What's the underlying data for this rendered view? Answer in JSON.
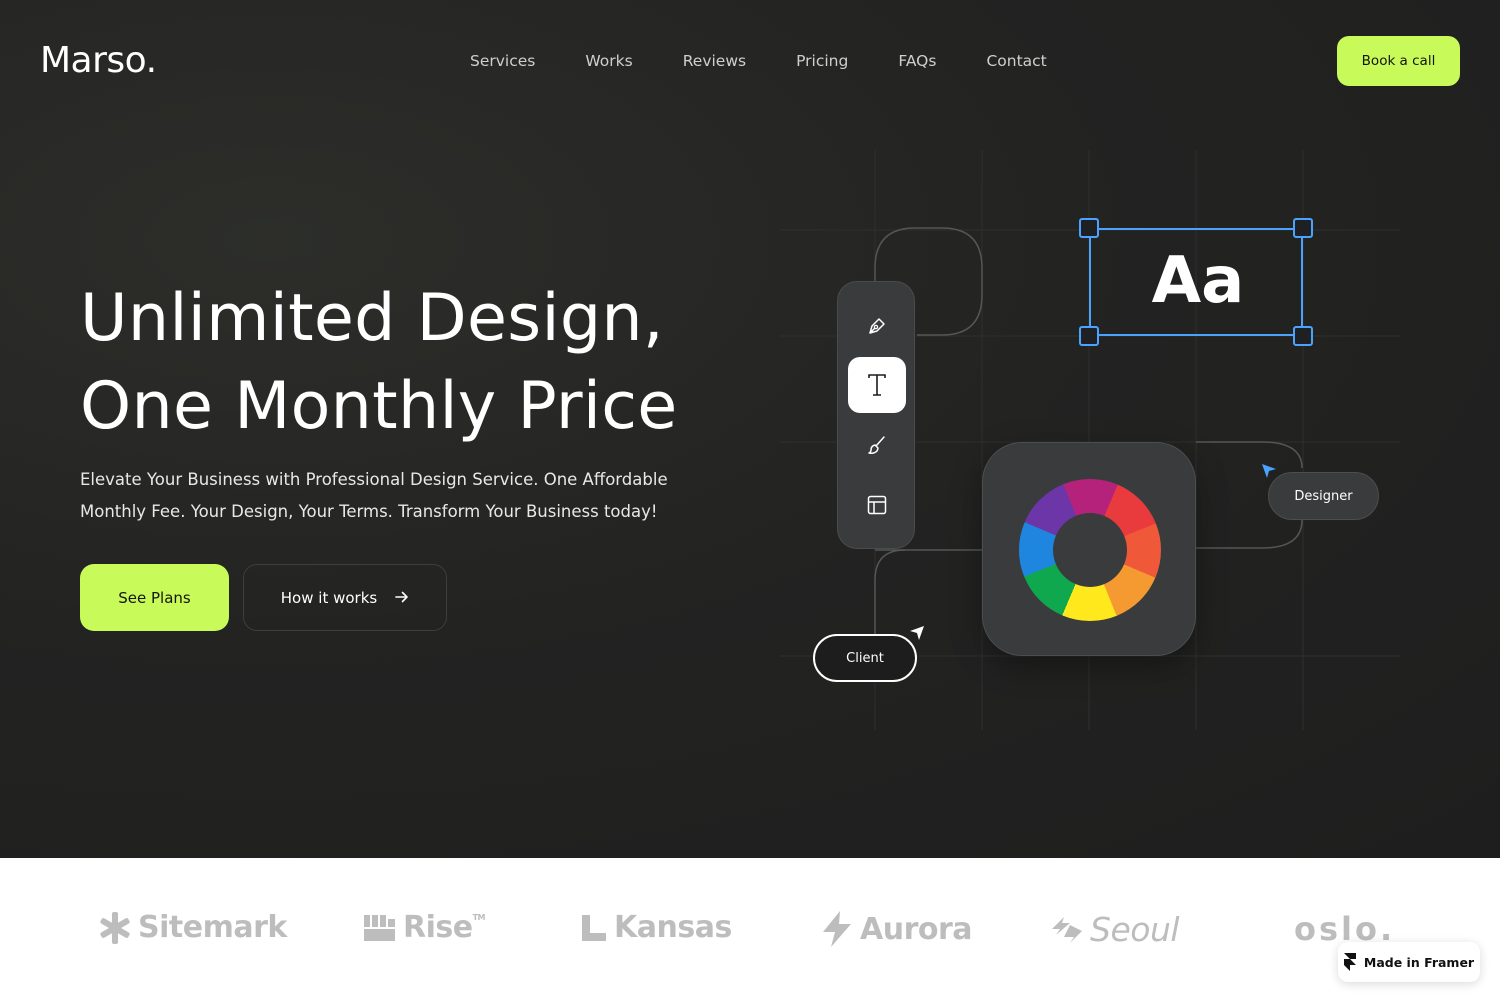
{
  "brand": {
    "logo_text": "Marso."
  },
  "nav": {
    "items": [
      "Services",
      "Works",
      "Reviews",
      "Pricing",
      "FAQs",
      "Contact"
    ],
    "cta_label": "Book a call"
  },
  "hero": {
    "headline_line1": "Unlimited Design,",
    "headline_line2": "One Monthly Price",
    "subheadline": "Elevate Your Business with Professional Design Service. One Affordable Monthly Fee. Your Design, Your Terms. Transform Your Business today!",
    "primary_cta": "See Plans",
    "secondary_cta": "How it works",
    "secondary_cta_icon": "arrow-right-icon"
  },
  "illustration": {
    "toolbar_tools": [
      "pen-tool-icon",
      "text-tool-icon",
      "brush-tool-icon",
      "layout-tool-icon"
    ],
    "active_tool": "text-tool-icon",
    "text_sample": "Aa",
    "designer_label": "Designer",
    "client_label": "Client",
    "color_wheel": [
      "#b4227c",
      "#e93b3e",
      "#f0583a",
      "#f59a30",
      "#ffe81c",
      "#10a84e",
      "#1f86e0",
      "#6c35a8"
    ],
    "selection_color": "#4aa3ff"
  },
  "logos": [
    "Sitemark",
    "Rise",
    "Kansas",
    "Aurora",
    "Seoul",
    "oslo."
  ],
  "logo_tm": "TM",
  "badge": {
    "label": "Made in Framer"
  },
  "colors": {
    "accent": "#c8fa5a",
    "background": "#232322",
    "text": "#ffffff"
  }
}
